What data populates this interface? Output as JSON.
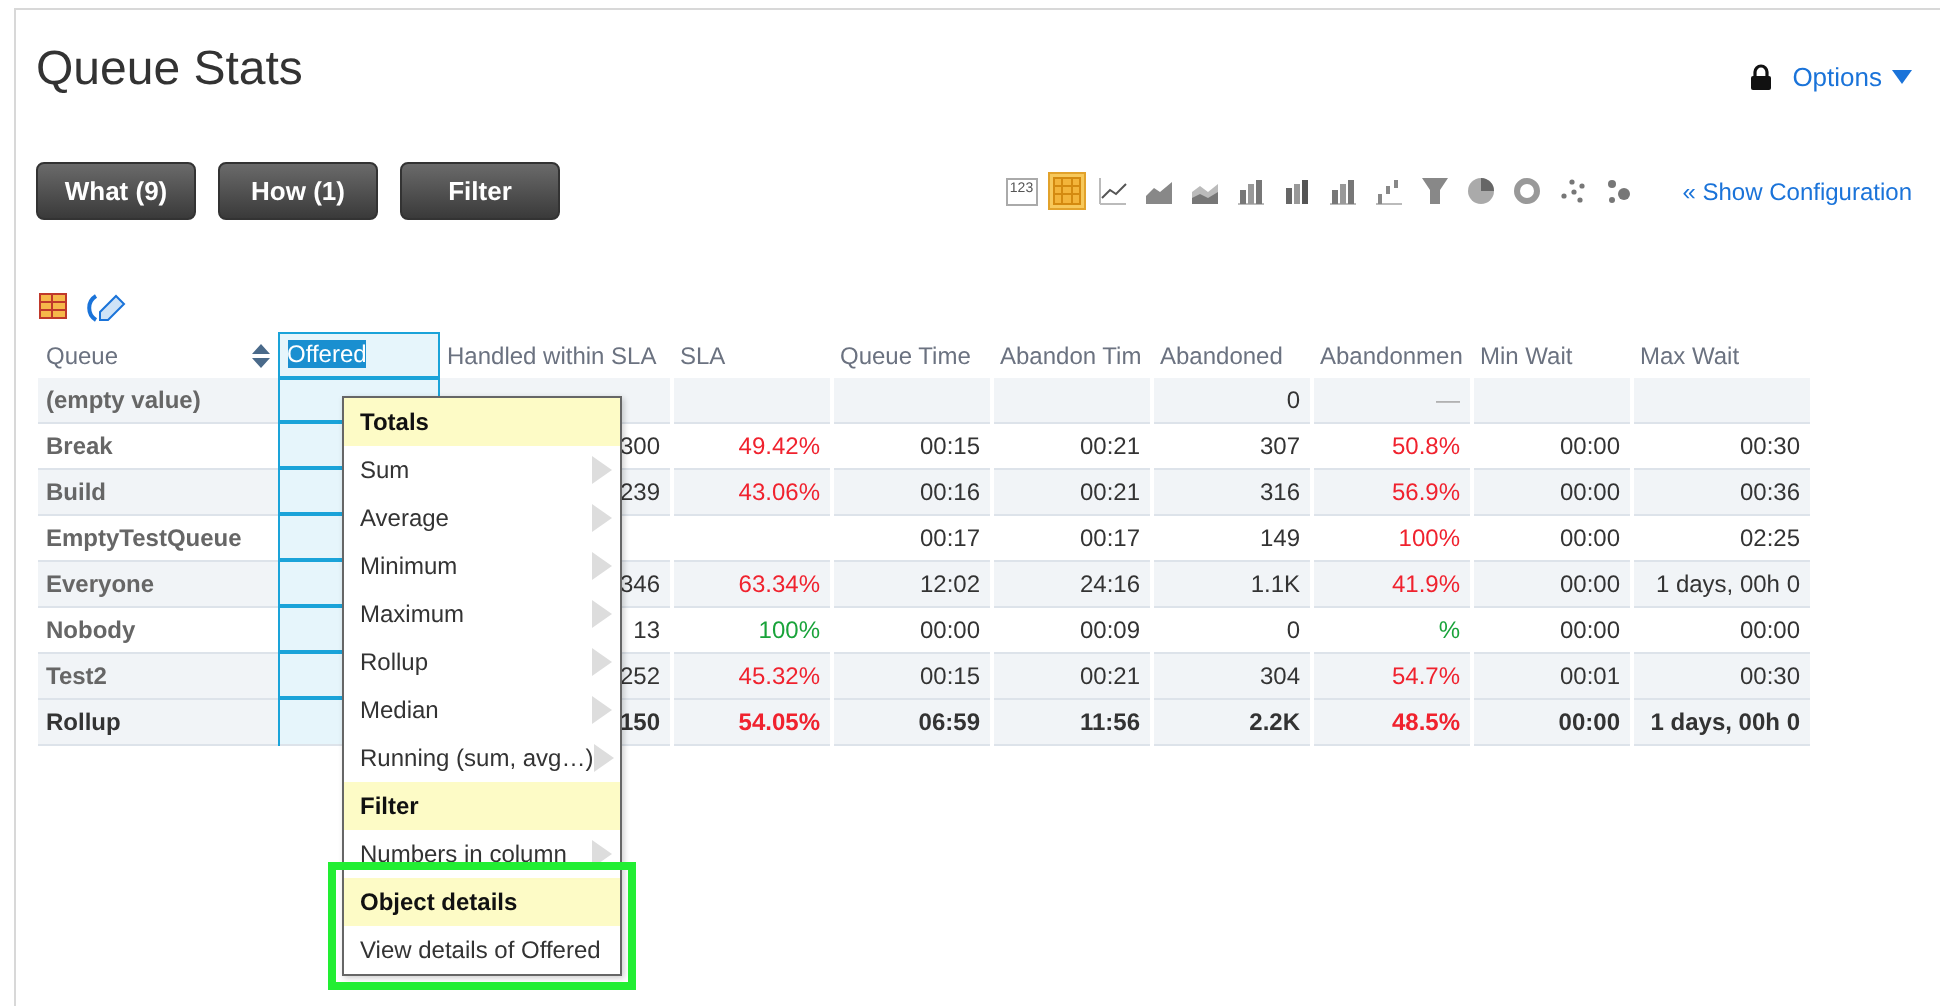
{
  "title": "Queue Stats",
  "options": {
    "label": "Options",
    "locked": true
  },
  "buttons": [
    {
      "label": "What (9)"
    },
    {
      "label": "How (1)"
    },
    {
      "label": "Filter"
    }
  ],
  "chart_types": [
    {
      "kind": "number",
      "label": "123",
      "selected": false
    },
    {
      "kind": "table",
      "selected": true
    },
    {
      "kind": "line",
      "selected": false
    },
    {
      "kind": "area",
      "selected": false
    },
    {
      "kind": "stacked-area",
      "selected": false
    },
    {
      "kind": "bar",
      "selected": false
    },
    {
      "kind": "stacked-bar",
      "selected": false
    },
    {
      "kind": "bar",
      "selected": false
    },
    {
      "kind": "waterfall",
      "selected": false
    },
    {
      "kind": "funnel",
      "selected": false
    },
    {
      "kind": "pie",
      "selected": false
    },
    {
      "kind": "donut",
      "selected": false
    },
    {
      "kind": "scatter",
      "selected": false
    },
    {
      "kind": "bubble",
      "selected": false
    }
  ],
  "show_configuration": "« Show Configuration",
  "table": {
    "columns": [
      {
        "label": "Queue",
        "selected": false,
        "sortable": true
      },
      {
        "label": "Offered",
        "selected": true
      },
      {
        "label": "Handled within SLA",
        "selected": false
      },
      {
        "label": "SLA",
        "selected": false
      },
      {
        "label": "Queue Time",
        "selected": false
      },
      {
        "label": "Abandon Tim",
        "selected": false
      },
      {
        "label": "Abandoned",
        "selected": false
      },
      {
        "label": "Abandonmen",
        "selected": false
      },
      {
        "label": "Min Wait",
        "selected": false
      },
      {
        "label": "Max Wait",
        "selected": false
      }
    ],
    "rows": [
      {
        "kind": "data",
        "cells": [
          {
            "text": "(empty value)"
          },
          {
            "text": ""
          },
          {
            "text": ""
          },
          {
            "text": ""
          },
          {
            "text": ""
          },
          {
            "text": ""
          },
          {
            "text": "0"
          },
          {
            "text": "—",
            "color": "#aaaaaa"
          },
          {
            "text": ""
          },
          {
            "text": ""
          }
        ]
      },
      {
        "kind": "data",
        "cells": [
          {
            "text": "Break"
          },
          {
            "text": ""
          },
          {
            "text": "300"
          },
          {
            "text": "49.42%",
            "color": "#f0222e"
          },
          {
            "text": "00:15"
          },
          {
            "text": "00:21"
          },
          {
            "text": "307"
          },
          {
            "text": "50.8%",
            "color": "#f0222e"
          },
          {
            "text": "00:00"
          },
          {
            "text": "00:30"
          }
        ]
      },
      {
        "kind": "data",
        "cells": [
          {
            "text": "Build"
          },
          {
            "text": ""
          },
          {
            "text": "239"
          },
          {
            "text": "43.06%",
            "color": "#f0222e"
          },
          {
            "text": "00:16"
          },
          {
            "text": "00:21"
          },
          {
            "text": "316"
          },
          {
            "text": "56.9%",
            "color": "#f0222e"
          },
          {
            "text": "00:00"
          },
          {
            "text": "00:36"
          }
        ]
      },
      {
        "kind": "data",
        "cells": [
          {
            "text": "EmptyTestQueue"
          },
          {
            "text": ""
          },
          {
            "text": ""
          },
          {
            "text": ""
          },
          {
            "text": "00:17"
          },
          {
            "text": "00:17"
          },
          {
            "text": "149"
          },
          {
            "text": "100%",
            "color": "#f0222e"
          },
          {
            "text": "00:00"
          },
          {
            "text": "02:25"
          }
        ]
      },
      {
        "kind": "data",
        "cells": [
          {
            "text": "Everyone"
          },
          {
            "text": ""
          },
          {
            "text": "346"
          },
          {
            "text": "63.34%",
            "color": "#f0222e"
          },
          {
            "text": "12:02"
          },
          {
            "text": "24:16"
          },
          {
            "text": "1.1K"
          },
          {
            "text": "41.9%",
            "color": "#f0222e"
          },
          {
            "text": "00:00"
          },
          {
            "text": "1 days, 00h 0"
          }
        ]
      },
      {
        "kind": "data",
        "cells": [
          {
            "text": "Nobody"
          },
          {
            "text": ""
          },
          {
            "text": "13"
          },
          {
            "text": "100%",
            "color": "#19a33a"
          },
          {
            "text": "00:00"
          },
          {
            "text": "00:09"
          },
          {
            "text": "0"
          },
          {
            "text": "%",
            "color": "#19a33a"
          },
          {
            "text": "00:00"
          },
          {
            "text": "00:00"
          }
        ]
      },
      {
        "kind": "data",
        "cells": [
          {
            "text": "Test2"
          },
          {
            "text": ""
          },
          {
            "text": "252"
          },
          {
            "text": "45.32%",
            "color": "#f0222e"
          },
          {
            "text": "00:15"
          },
          {
            "text": "00:21"
          },
          {
            "text": "304"
          },
          {
            "text": "54.7%",
            "color": "#f0222e"
          },
          {
            "text": "00:01"
          },
          {
            "text": "00:30"
          }
        ]
      },
      {
        "kind": "total",
        "cells": [
          {
            "text": "Rollup"
          },
          {
            "text": ""
          },
          {
            "text": "150"
          },
          {
            "text": "54.05%",
            "color": "#f0222e"
          },
          {
            "text": "06:59"
          },
          {
            "text": "11:56"
          },
          {
            "text": "2.2K"
          },
          {
            "text": "48.5%",
            "color": "#f0222e"
          },
          {
            "text": "00:00"
          },
          {
            "text": "1 days, 00h 0"
          }
        ]
      }
    ]
  },
  "context_menu": {
    "sections": [
      {
        "title": "Totals",
        "highlighted": false,
        "items": [
          {
            "label": "Sum",
            "submenu": true
          },
          {
            "label": "Average",
            "submenu": true
          },
          {
            "label": "Minimum",
            "submenu": true
          },
          {
            "label": "Maximum",
            "submenu": true
          },
          {
            "label": "Rollup",
            "submenu": true
          },
          {
            "label": "Median",
            "submenu": true
          },
          {
            "label": "Running (sum, avg…)",
            "submenu": true
          }
        ]
      },
      {
        "title": "Filter",
        "highlighted": false,
        "items": [
          {
            "label": "Numbers in column",
            "submenu": true
          }
        ]
      },
      {
        "title": "Object details",
        "highlighted": true,
        "items": [
          {
            "label": "View details of Offered",
            "submenu": false
          }
        ]
      }
    ]
  }
}
